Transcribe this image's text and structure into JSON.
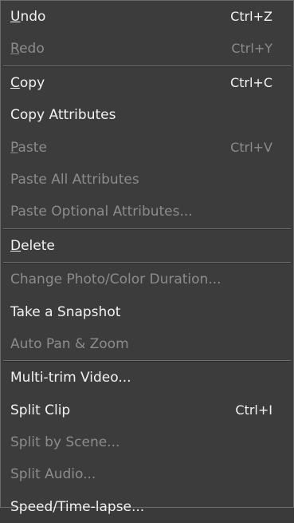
{
  "menu": {
    "items": [
      {
        "label": "Undo",
        "underline_index": 0,
        "shortcut": "Ctrl+Z",
        "enabled": true
      },
      {
        "label": "Redo",
        "underline_index": 0,
        "shortcut": "Ctrl+Y",
        "enabled": false
      },
      {
        "separator": true
      },
      {
        "label": "Copy",
        "underline_index": 0,
        "shortcut": "Ctrl+C",
        "enabled": true
      },
      {
        "label": "Copy Attributes",
        "shortcut": "",
        "enabled": true
      },
      {
        "label": "Paste",
        "underline_index": 0,
        "shortcut": "Ctrl+V",
        "enabled": false
      },
      {
        "label": "Paste All Attributes",
        "shortcut": "",
        "enabled": false
      },
      {
        "label": "Paste Optional Attributes...",
        "shortcut": "",
        "enabled": false
      },
      {
        "separator": true
      },
      {
        "label": "Delete",
        "underline_index": 0,
        "shortcut": "",
        "enabled": true
      },
      {
        "separator": true
      },
      {
        "label": "Change Photo/Color Duration...",
        "shortcut": "",
        "enabled": false
      },
      {
        "label": "Take a Snapshot",
        "shortcut": "",
        "enabled": true
      },
      {
        "label": "Auto Pan & Zoom",
        "shortcut": "",
        "enabled": false
      },
      {
        "separator": true
      },
      {
        "label": "Multi-trim Video...",
        "shortcut": "",
        "enabled": true
      },
      {
        "label": "Split Clip",
        "shortcut": "Ctrl+I",
        "enabled": true
      },
      {
        "label": "Split by Scene...",
        "shortcut": "",
        "enabled": false
      },
      {
        "label": "Split Audio...",
        "shortcut": "",
        "enabled": false
      },
      {
        "label": "Speed/Time-lapse...",
        "shortcut": "",
        "enabled": true
      }
    ]
  },
  "colors": {
    "background": "#3c3c3c",
    "enabled_text": "#f2f2f2",
    "disabled_text": "#8c8c8c"
  }
}
